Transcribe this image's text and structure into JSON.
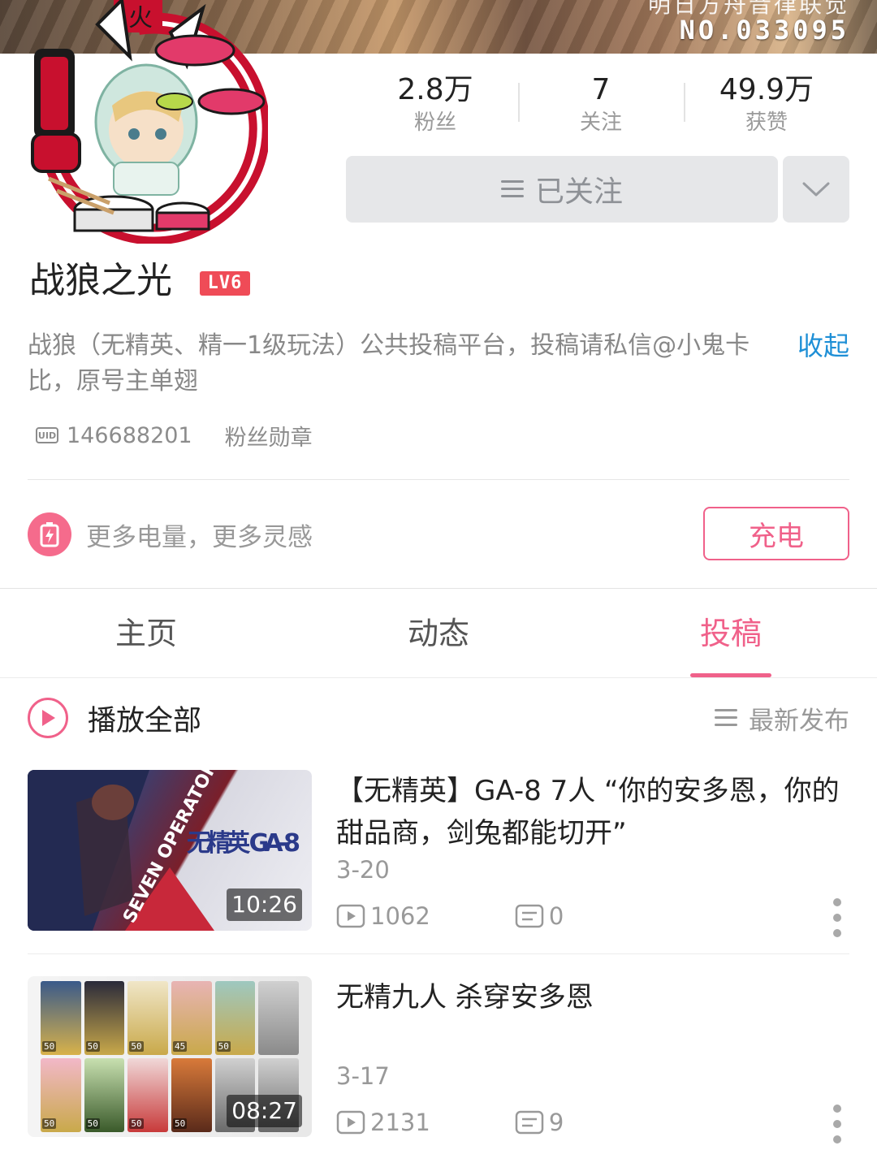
{
  "banner": {
    "top_text": "明日方舟音律联觉",
    "number": "NO.033095"
  },
  "profile": {
    "name": "战狼之光",
    "level": "LV6",
    "stats": [
      {
        "value": "2.8万",
        "label": "粉丝"
      },
      {
        "value": "7",
        "label": "关注"
      },
      {
        "value": "49.9万",
        "label": "获赞"
      }
    ],
    "follow_label": "已关注",
    "bio": "战狼（无精英、精一1级玩法）公共投稿平台，投稿请私信@小鬼卡比，原号主单翅",
    "collapse_label": "收起",
    "uid": "146688201",
    "medal_label": "粉丝勋章"
  },
  "charge": {
    "text": "更多电量，更多灵感",
    "button_label": "充电"
  },
  "tabs": [
    {
      "label": "主页",
      "active": false
    },
    {
      "label": "动态",
      "active": false
    },
    {
      "label": "投稿",
      "active": true
    }
  ],
  "list_header": {
    "play_all_label": "播放全部",
    "sort_label": "最新发布"
  },
  "videos": [
    {
      "title": "【无精英】GA-8 7人 “你的安多恩，你的甜品商，剑兔都能切开”",
      "date": "3-20",
      "duration": "10:26",
      "views": "1062",
      "comments": "0",
      "thumb_text": "无精英 GA-8",
      "thumb_sub": "SEVEN OPERATORS"
    },
    {
      "title": "无精九人 杀穿安多恩",
      "date": "3-17",
      "duration": "08:27",
      "views": "2131",
      "comments": "9",
      "card_levels": [
        "50",
        "50",
        "50",
        "45",
        "50",
        "",
        "50",
        "50",
        "50",
        "50",
        "",
        ""
      ]
    }
  ],
  "colors": {
    "accent_pink": "#f0618a",
    "link_blue": "#1e8fd6",
    "level_red": "#ef4b57"
  },
  "icons": {
    "play_all": "play-circle-icon",
    "sort": "menu-lines-icon",
    "charge": "battery-bolt-icon",
    "views": "play-box-icon",
    "comments": "comment-box-icon",
    "more": "chevron-down-icon",
    "kebab": "vertical-dots-icon"
  }
}
